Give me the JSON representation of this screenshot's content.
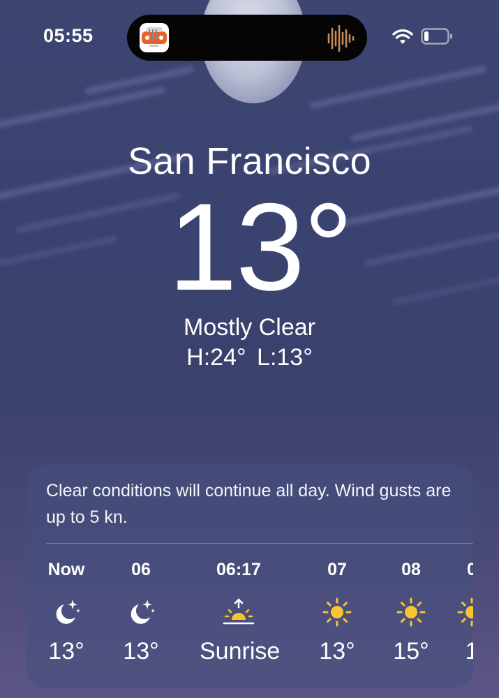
{
  "status_bar": {
    "time": "05:55",
    "icons": [
      "app-icon",
      "audio-wave-icon",
      "wifi-icon",
      "battery-icon"
    ]
  },
  "weather": {
    "city": "San Francisco",
    "temperature": "13°",
    "condition": "Mostly Clear",
    "high_low": "H:24°  L:13°"
  },
  "forecast_card": {
    "summary": "Clear conditions will continue all day. Wind gusts are up to 5 kn.",
    "hours": [
      {
        "time": "Now",
        "icon": "moon-stars-icon",
        "temp": "13°"
      },
      {
        "time": "06",
        "icon": "moon-stars-icon",
        "temp": "13°"
      },
      {
        "time": "06:17",
        "icon": "sunrise-icon",
        "temp": "Sunrise"
      },
      {
        "time": "07",
        "icon": "sun-icon",
        "temp": "13°"
      },
      {
        "time": "08",
        "icon": "sun-icon",
        "temp": "15°"
      },
      {
        "time": "0",
        "icon": "sun-icon",
        "temp": "1"
      }
    ]
  },
  "colors": {
    "sun_yellow": "#f7c531",
    "app_orange": "#e8612a"
  }
}
